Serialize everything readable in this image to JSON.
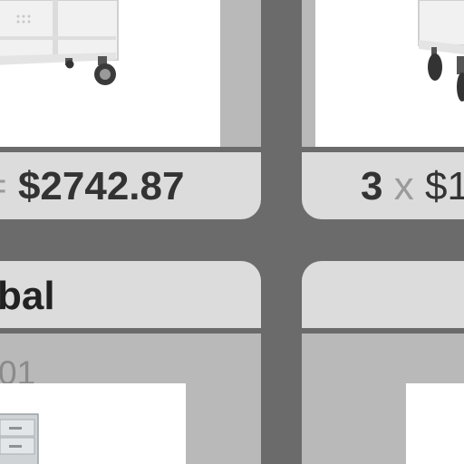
{
  "products": [
    {
      "position": "top-left",
      "price_line": {
        "multiplier": "=",
        "total": "$2742.87"
      }
    },
    {
      "position": "top-right",
      "price_line": {
        "quantity": "3",
        "times": "x",
        "unit_price": "$1"
      }
    },
    {
      "position": "bottom-left",
      "title": "bal",
      "sku": "01"
    },
    {
      "position": "bottom-right"
    }
  ],
  "colors": {
    "background": "#6b6b6b",
    "price_panel": "#dcdcdc",
    "card_body": "#b9b9b9",
    "image_bg": "#ffffff"
  },
  "icons": [
    "storage-cart-image",
    "storage-cart-image",
    "file-cabinet-image"
  ]
}
